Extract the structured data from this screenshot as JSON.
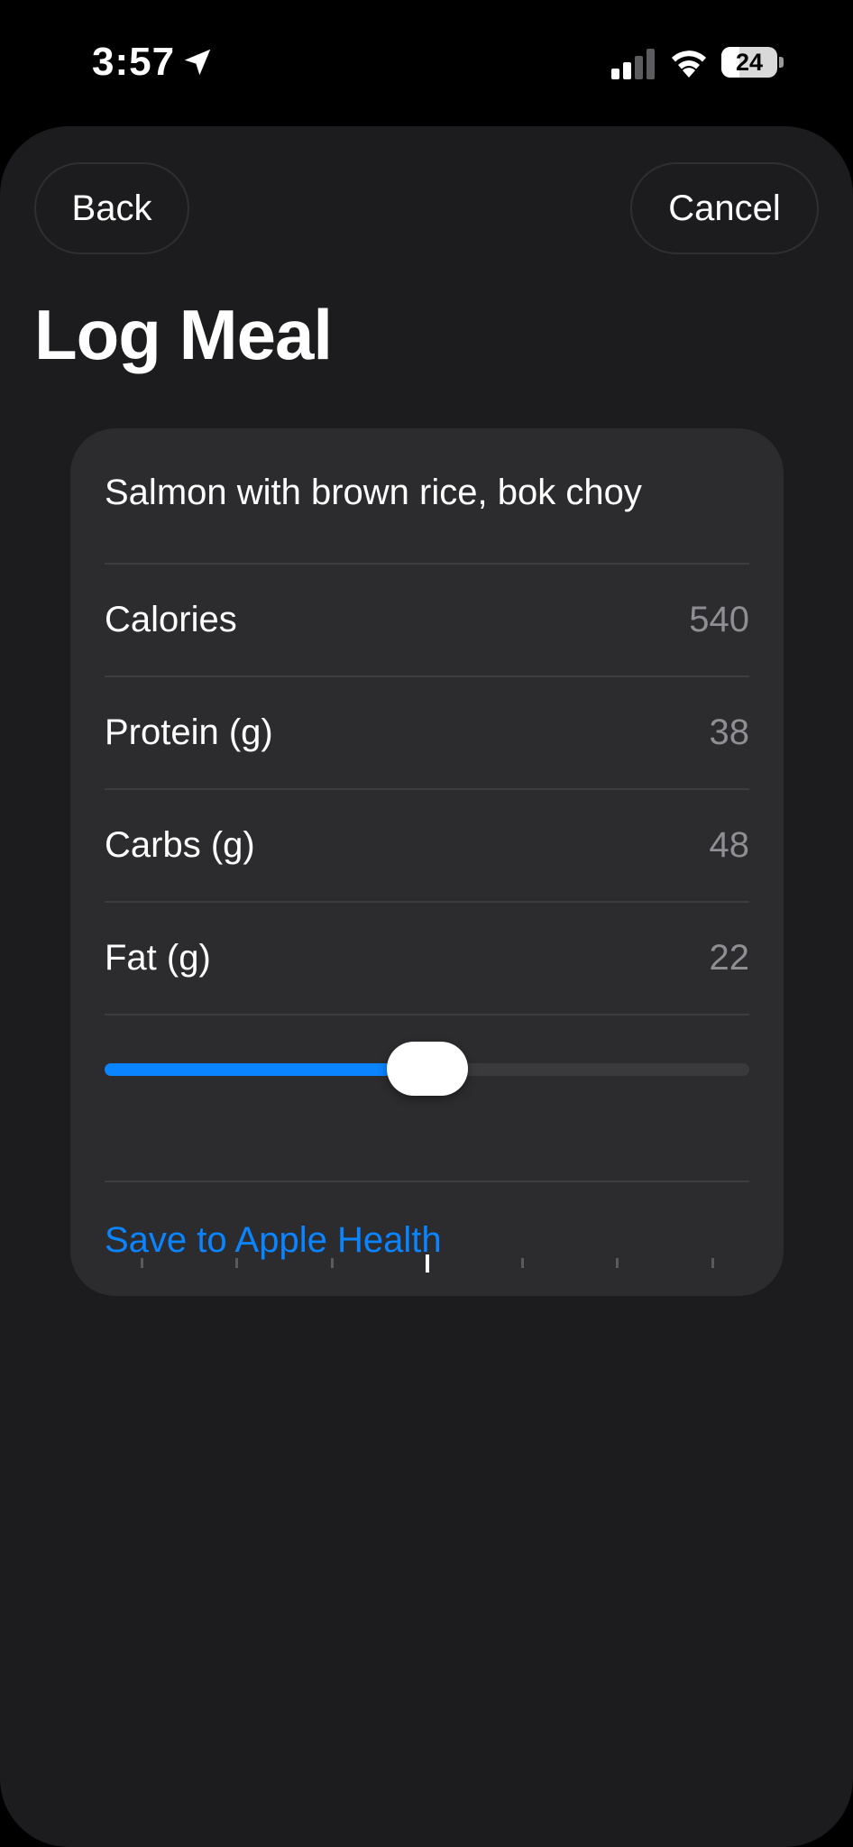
{
  "status_bar": {
    "time": "3:57",
    "battery_level": "24",
    "icons": [
      "location-arrow-icon",
      "cellular-signal-icon",
      "wifi-icon",
      "battery-icon"
    ]
  },
  "nav": {
    "back_label": "Back",
    "cancel_label": "Cancel"
  },
  "page": {
    "title": "Log Meal"
  },
  "meal": {
    "description": "Salmon with brown rice, bok choy",
    "rows": [
      {
        "label": "Calories",
        "value": "540"
      },
      {
        "label": "Protein (g)",
        "value": "38"
      },
      {
        "label": "Carbs (g)",
        "value": "48"
      },
      {
        "label": "Fat (g)",
        "value": "22"
      }
    ]
  },
  "slider": {
    "value_fraction": 0.5,
    "tick_count": 7,
    "selected_tick_index": 3
  },
  "actions": {
    "save_label": "Save to Apple Health"
  },
  "colors": {
    "accent": "#0a84ff",
    "sheet_background": "#1c1c1e",
    "card_background": "#2c2c2e",
    "secondary_text": "#8e8e93"
  }
}
